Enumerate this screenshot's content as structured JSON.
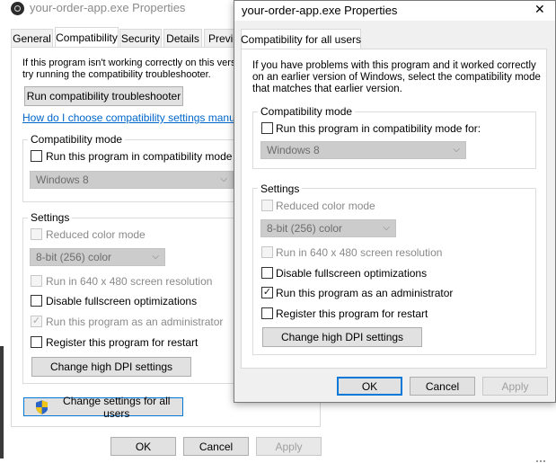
{
  "back_window": {
    "title": "your-order-app.exe Properties",
    "tabs": [
      "General",
      "Compatibility",
      "Security",
      "Details",
      "Previc"
    ],
    "intro_line1": "If this program isn't working correctly on this version",
    "intro_line2": "try running the compatibility troubleshooter.",
    "troubleshooter_button": "Run compatibility troubleshooter",
    "help_link": "How do I choose compatibility settings manually?",
    "compat_group_title": "Compatibility mode",
    "compat_checkbox": "Run this program in compatibility mode for:",
    "compat_select": "Windows 8",
    "settings_group_title": "Settings",
    "reduced_color": "Reduced color mode",
    "color_select": "8-bit (256) color",
    "run_640": "Run in 640 x 480 screen resolution",
    "disable_fullscreen": "Disable fullscreen optimizations",
    "run_admin": "Run this program as an administrator",
    "register_restart": "Register this program for restart",
    "high_dpi_button": "Change high DPI settings",
    "all_users_button": "Change settings for all users",
    "ok": "OK",
    "cancel": "Cancel",
    "apply": "Apply"
  },
  "front_window": {
    "title": "your-order-app.exe Properties",
    "close_glyph": "✕",
    "tab": "Compatibility for all users",
    "intro_line1": "If you have problems with this program and it worked correctly",
    "intro_line2": "on an earlier version of Windows, select the compatibility mode",
    "intro_line3": "that matches that earlier version.",
    "compat_group_title": "Compatibility mode",
    "compat_checkbox": "Run this program in compatibility mode for:",
    "compat_select": "Windows 8",
    "settings_group_title": "Settings",
    "reduced_color": "Reduced color mode",
    "color_select": "8-bit (256) color",
    "run_640": "Run in 640 x 480 screen resolution",
    "disable_fullscreen": "Disable fullscreen optimizations",
    "run_admin": "Run this program as an administrator",
    "register_restart": "Register this program for restart",
    "high_dpi_button": "Change high DPI settings",
    "ok": "OK",
    "cancel": "Cancel",
    "apply": "Apply"
  },
  "checkmark": "✓",
  "colors": {
    "accent": "#0078d7",
    "link": "#0066cc",
    "button_face": "#e1e1e1",
    "select_face": "#cccccc"
  }
}
